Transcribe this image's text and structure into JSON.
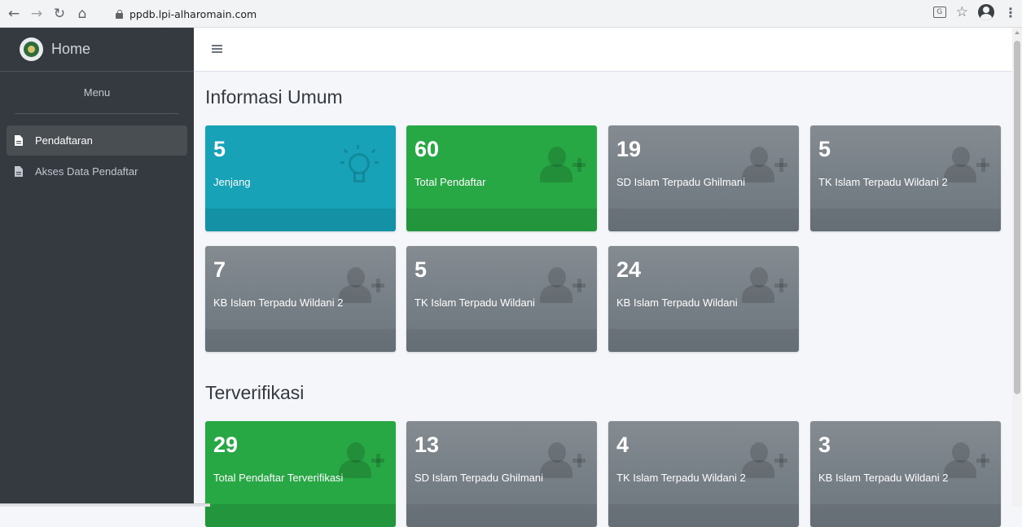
{
  "browser": {
    "url": "ppdb.lpi-alharomain.com",
    "back_icon": "arrow-left",
    "forward_icon": "arrow-right",
    "reload_icon": "reload",
    "home_icon": "home",
    "translate_label": "G"
  },
  "sidebar": {
    "brand": "Home",
    "menu_header": "Menu",
    "items": [
      {
        "label": "Pendaftaran",
        "active": true
      },
      {
        "label": "Akses Data Pendaftar",
        "active": false
      }
    ]
  },
  "sections": [
    {
      "title": "Informasi Umum",
      "cards": [
        {
          "value": "5",
          "label": "Jenjang",
          "color": "#17a2b8",
          "icon": "lightbulb-icon"
        },
        {
          "value": "60",
          "label": "Total Pendaftar",
          "color": "#28a745",
          "icon": "user-plus-icon"
        },
        {
          "value": "19",
          "label": "SD Islam Terpadu Ghilmani",
          "color": "#6c757d",
          "icon": "user-plus-icon"
        },
        {
          "value": "5",
          "label": "TK Islam Terpadu Wildani 2",
          "color": "#6c757d",
          "icon": "user-plus-icon"
        },
        {
          "value": "7",
          "label": "KB Islam Terpadu Wildani 2",
          "color": "#6c757d",
          "icon": "user-plus-icon"
        },
        {
          "value": "5",
          "label": "TK Islam Terpadu Wildani",
          "color": "#6c757d",
          "icon": "user-plus-icon"
        },
        {
          "value": "24",
          "label": "KB Islam Terpadu Wildani",
          "color": "#6c757d",
          "icon": "user-plus-icon"
        }
      ]
    },
    {
      "title": "Terverifikasi",
      "cards": [
        {
          "value": "29",
          "label": "Total Pendaftar Terverifikasi",
          "color": "#28a745",
          "icon": "user-plus-icon"
        },
        {
          "value": "13",
          "label": "SD Islam Terpadu Ghilmani",
          "color": "#6c757d",
          "icon": "user-plus-icon"
        },
        {
          "value": "4",
          "label": "TK Islam Terpadu Wildani 2",
          "color": "#6c757d",
          "icon": "user-plus-icon"
        },
        {
          "value": "3",
          "label": "KB Islam Terpadu Wildani 2",
          "color": "#6c757d",
          "icon": "user-plus-icon"
        }
      ]
    }
  ]
}
